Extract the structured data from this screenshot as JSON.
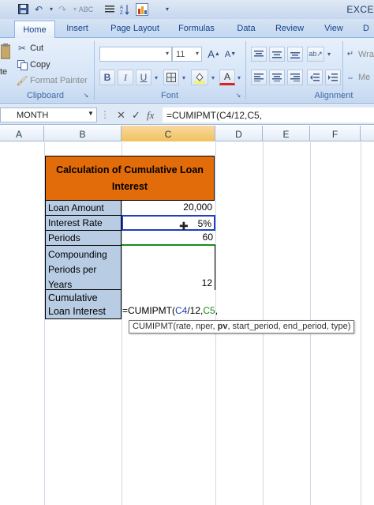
{
  "app": {
    "title": "EXCE"
  },
  "quick_access": [
    "save-icon",
    "undo-icon",
    "redo-icon",
    "spelling-icon",
    "align-icon",
    "sort-icon",
    "chart-icon"
  ],
  "tabs": [
    {
      "label": "Home",
      "active": true
    },
    {
      "label": "Insert"
    },
    {
      "label": "Page Layout"
    },
    {
      "label": "Formulas"
    },
    {
      "label": "Data"
    },
    {
      "label": "Review"
    },
    {
      "label": "View"
    },
    {
      "label": "D"
    }
  ],
  "ribbon": {
    "clipboard": {
      "paste_label": "te",
      "cut": "Cut",
      "copy": "Copy",
      "format_painter": "Format Painter",
      "group_label": "Clipboard"
    },
    "font": {
      "font_name": "",
      "font_size": "11",
      "bold": "B",
      "italic": "I",
      "underline": "U",
      "group_label": "Font"
    },
    "alignment": {
      "wrap": "Wra",
      "merge": "Me",
      "group_label": "Alignment"
    }
  },
  "formula_bar": {
    "name_box": "MONTH",
    "cancel": "✕",
    "enter": "✓",
    "fx": "fx",
    "formula": "=CUMIPMT(C4/12,C5,"
  },
  "columns": [
    "A",
    "B",
    "C",
    "D",
    "E",
    "F"
  ],
  "table": {
    "title": "Calculation of Cumulative Loan Interest",
    "rows": [
      {
        "label": "Loan Amount",
        "value": "20,000"
      },
      {
        "label": "Interest Rate",
        "value": "5%"
      },
      {
        "label": "Periods",
        "value": "60"
      },
      {
        "label": "Compounding Periods per Years",
        "value": "12"
      },
      {
        "label": "Cumulative Loan Interest",
        "value": ""
      }
    ],
    "edit_formula": {
      "prefix": "=CUMIPMT(",
      "ref1": "C4",
      "mid": "/12,",
      "ref2": "C5",
      "suffix": ","
    }
  },
  "tooltip": {
    "func": "CUMIPMT(",
    "args_before": "rate, nper, ",
    "active_arg": "pv",
    "args_after": ", start_period, end_period, type)"
  },
  "colors": {
    "title_fill": "#e36c0a",
    "label_fill": "#b8cce4",
    "ref1": "#1f3fbf",
    "ref2": "#1a8c1a"
  }
}
